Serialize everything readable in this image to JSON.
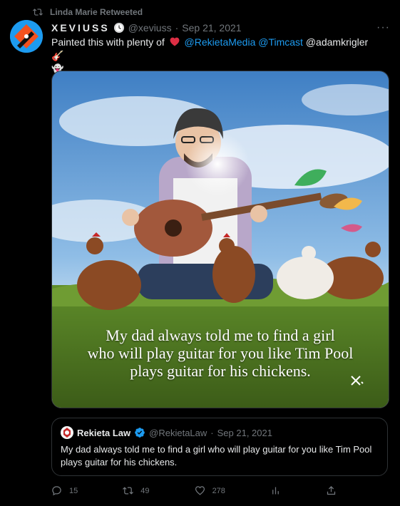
{
  "retweet": {
    "text": "Linda Marie Retweeted"
  },
  "tweet": {
    "display_name": "XEVIUSS",
    "handle": "@xeviuss",
    "separator": "·",
    "date": "Sep 21, 2021",
    "more": "···",
    "text_intro": "Painted this with plenty of",
    "mention_1": "@RekietaMedia",
    "mention_2": "@Timcast",
    "mention_3": "@adamkrigler",
    "emoji_guitar": "🎸",
    "emoji_ghost": "👻"
  },
  "media": {
    "caption": "My dad always told me to find a girl\nwho will play guitar for you like Tim Pool\nplays guitar for his chickens."
  },
  "quote": {
    "name": "Rekieta Law",
    "handle": "@RekietaLaw",
    "separator": "·",
    "date": "Sep 21, 2021",
    "text": "My dad always told me to find a girl who will play guitar for you like Tim Pool plays guitar for his chickens."
  },
  "actions": {
    "replies": "15",
    "retweets": "49",
    "likes": "278"
  },
  "colors": {
    "accent": "#1d9bf0",
    "like_heart": "#f91880",
    "muted": "#71767b"
  },
  "icons": [
    "retweet-icon",
    "clock-icon",
    "heart-icon",
    "verified-badge-icon",
    "reply-icon",
    "like-icon",
    "analytics-icon",
    "share-icon"
  ]
}
